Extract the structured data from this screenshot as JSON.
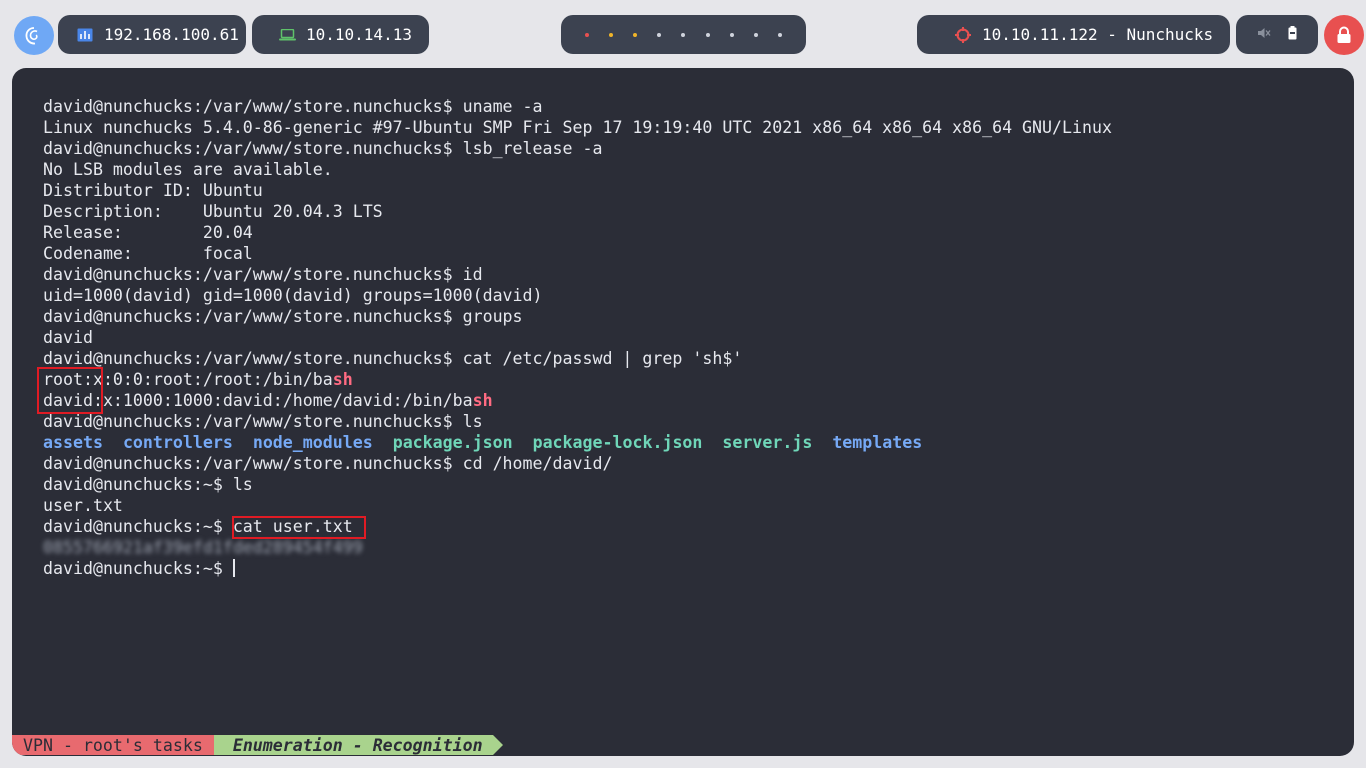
{
  "topbar": {
    "host_ip": "192.168.100.61",
    "vpn_ip": "10.10.14.13",
    "target_label": "10.10.11.122 - Nunchucks",
    "workspace_count": 9,
    "colors": {
      "accent_blue": "#6fa8f5",
      "danger_red": "#e85050",
      "pill_bg": "#3c4250"
    }
  },
  "terminal": {
    "lines": [
      {
        "parts": [
          {
            "t": "david@nunchucks:/var/www/store.nunchucks$ uname -a"
          }
        ]
      },
      {
        "parts": [
          {
            "t": "Linux nunchucks 5.4.0-86-generic #97-Ubuntu SMP Fri Sep 17 19:19:40 UTC 2021 x86_64 x86_64 x86_64 GNU/Linux"
          }
        ]
      },
      {
        "parts": [
          {
            "t": "david@nunchucks:/var/www/store.nunchucks$ lsb_release -a"
          }
        ]
      },
      {
        "parts": [
          {
            "t": "No LSB modules are available."
          }
        ]
      },
      {
        "parts": [
          {
            "t": "Distributor ID: Ubuntu"
          }
        ]
      },
      {
        "parts": [
          {
            "t": "Description:    Ubuntu 20.04.3 LTS"
          }
        ]
      },
      {
        "parts": [
          {
            "t": "Release:        20.04"
          }
        ]
      },
      {
        "parts": [
          {
            "t": "Codename:       focal"
          }
        ]
      },
      {
        "parts": [
          {
            "t": "david@nunchucks:/var/www/store.nunchucks$ id"
          }
        ]
      },
      {
        "parts": [
          {
            "t": "uid=1000(david) gid=1000(david) groups=1000(david)"
          }
        ]
      },
      {
        "parts": [
          {
            "t": "david@nunchucks:/var/www/store.nunchucks$ groups"
          }
        ]
      },
      {
        "parts": [
          {
            "t": "david"
          }
        ]
      },
      {
        "parts": [
          {
            "t": "david@nunchucks:/var/www/store.nunchucks$ cat /etc/passwd | grep 'sh$'"
          }
        ]
      },
      {
        "parts": [
          {
            "t": "root:x:0:0:root:/root:/bin/ba"
          },
          {
            "t": "sh",
            "c": "sh"
          }
        ]
      },
      {
        "parts": [
          {
            "t": "david:x:1000:1000:david:/home/david:/bin/ba"
          },
          {
            "t": "sh",
            "c": "sh"
          }
        ]
      },
      {
        "parts": [
          {
            "t": "david@nunchucks:/var/www/store.nunchucks$ ls"
          }
        ]
      },
      {
        "parts": [
          {
            "t": "assets",
            "c": "dir"
          },
          {
            "t": "  "
          },
          {
            "t": "controllers",
            "c": "dir"
          },
          {
            "t": "  "
          },
          {
            "t": "node_modules",
            "c": "dir"
          },
          {
            "t": "  "
          },
          {
            "t": "package.json",
            "c": "file"
          },
          {
            "t": "  "
          },
          {
            "t": "package-lock.json",
            "c": "file"
          },
          {
            "t": "  "
          },
          {
            "t": "server.js",
            "c": "file"
          },
          {
            "t": "  "
          },
          {
            "t": "templates",
            "c": "dir"
          }
        ]
      },
      {
        "parts": [
          {
            "t": "david@nunchucks:/var/www/store.nunchucks$ cd /home/david/"
          }
        ]
      },
      {
        "parts": [
          {
            "t": "david@nunchucks:~$ ls"
          }
        ]
      },
      {
        "parts": [
          {
            "t": "user.txt"
          }
        ]
      },
      {
        "parts": [
          {
            "t": "david@nunchucks:~$ cat user.txt"
          }
        ]
      },
      {
        "parts": [
          {
            "t": "0855766921af39efd1fded289454f499",
            "c": "blur"
          }
        ]
      },
      {
        "parts": [
          {
            "t": "david@nunchucks:~$ "
          }
        ],
        "cursor": true
      }
    ]
  },
  "statusbar": {
    "session": "VPN - root's tasks",
    "window": "Enumeration - Recognition"
  }
}
